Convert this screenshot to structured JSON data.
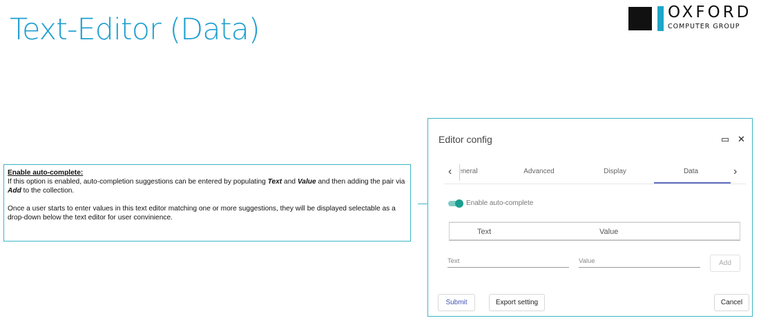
{
  "slide": {
    "title": "Text-Editor (Data)"
  },
  "logo": {
    "word": "OXFORD",
    "sub": "COMPUTER GROUP"
  },
  "note": {
    "heading": "Enable auto-complete:",
    "para1_a": "If this option is enabled, auto-completion suggestions can be entered by populating ",
    "para1_text": "Text",
    "para1_b": " and ",
    "para1_value": "Value",
    "para1_c": " and then adding the pair via ",
    "para1_add": "Add",
    "para1_d": " to the collection.",
    "para2": "Once a user starts to enter values in this text editor matching one or more suggestions, they will be displayed selectable as a drop-down below the text editor for user convinience."
  },
  "dialog": {
    "title": "Editor config",
    "maximize_glyph": "▭",
    "close_glyph": "✕",
    "tabs": {
      "prev_glyph": "‹",
      "next_glyph": "›",
      "items": [
        {
          "label": "General"
        },
        {
          "label": "Advanced"
        },
        {
          "label": "Display"
        },
        {
          "label": "Data"
        }
      ],
      "active": "Data"
    },
    "toggle": {
      "label": "Enable auto-complete",
      "on": true
    },
    "table": {
      "col_text": "Text",
      "col_value": "Value"
    },
    "text_field": {
      "placeholder": "Text",
      "value": ""
    },
    "value_field": {
      "placeholder": "Value",
      "value": ""
    },
    "add_label": "Add",
    "submit_label": "Submit",
    "export_label": "Export setting",
    "cancel_label": "Cancel"
  },
  "colors": {
    "accent": "#1f9fd0",
    "border": "#3bb5c4",
    "tab_active": "#5c6bc0",
    "toggle": "#1a9f8e"
  }
}
